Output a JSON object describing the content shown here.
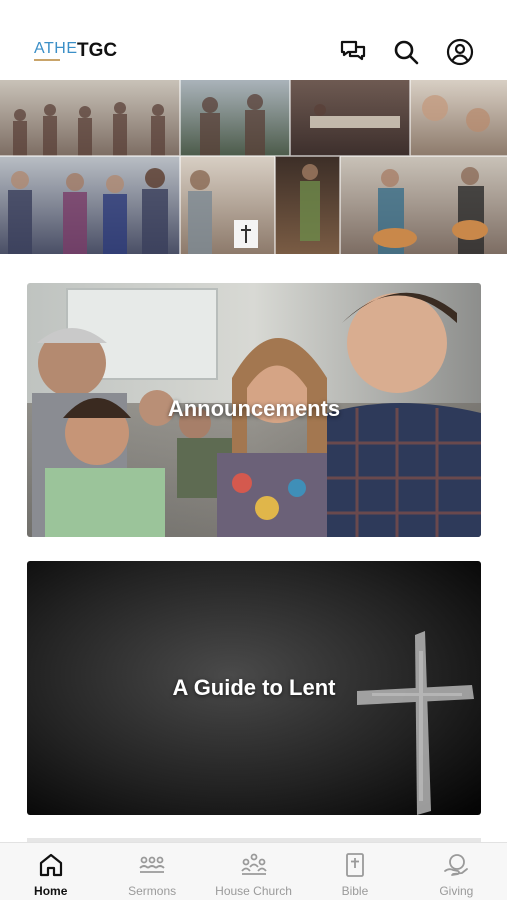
{
  "header": {
    "logo_text": "ATHE",
    "title": "TGC",
    "icons": [
      "chat-icon",
      "search-icon",
      "profile-icon"
    ]
  },
  "cards": [
    {
      "title": "Announcements"
    },
    {
      "title": "A Guide to Lent"
    }
  ],
  "tabs": [
    {
      "label": "Home",
      "icon": "home-icon",
      "active": true
    },
    {
      "label": "Sermons",
      "icon": "sermons-icon",
      "active": false
    },
    {
      "label": "House Church",
      "icon": "house-church-icon",
      "active": false
    },
    {
      "label": "Bible",
      "icon": "bible-icon",
      "active": false
    },
    {
      "label": "Giving",
      "icon": "giving-icon",
      "active": false
    }
  ],
  "colors": {
    "logo_blue": "#3b8fc7",
    "logo_gold": "#c9a46a",
    "active_tab": "#111111",
    "inactive_tab": "#9a9a9a"
  }
}
